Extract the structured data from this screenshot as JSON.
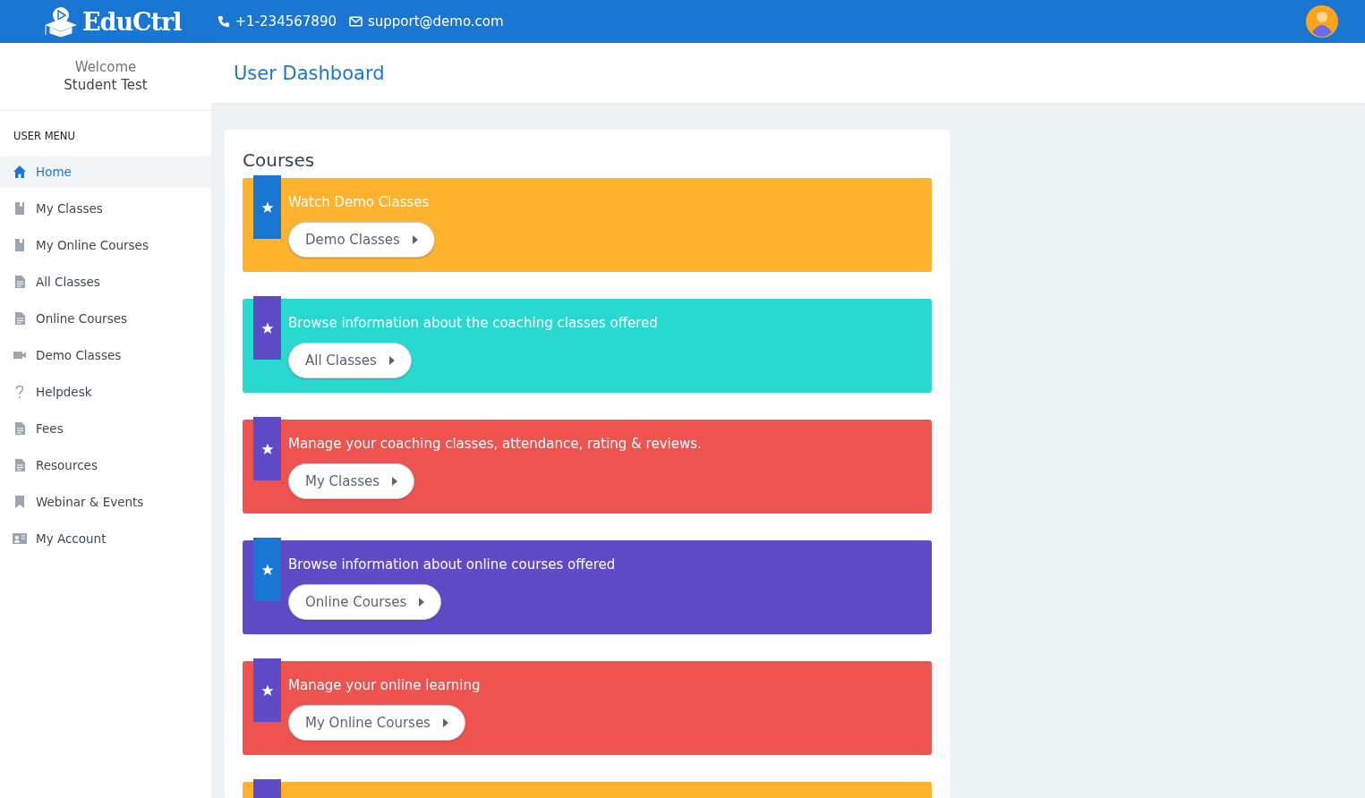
{
  "header": {
    "logo": "EduCtrl",
    "phone": "+1-234567890",
    "email": "support@demo.com"
  },
  "sidebar": {
    "welcome": "Welcome",
    "user": "Student Test",
    "menu_title": "USER MENU",
    "items": [
      {
        "label": "Home",
        "kind": "home",
        "selected": true
      },
      {
        "label": "My Classes",
        "kind": "book",
        "selected": false
      },
      {
        "label": "My Online Courses",
        "kind": "book",
        "selected": false
      },
      {
        "label": "All Classes",
        "kind": "document",
        "selected": false
      },
      {
        "label": "Online Courses",
        "kind": "document",
        "selected": false
      },
      {
        "label": "Demo Classes",
        "kind": "video",
        "selected": false
      },
      {
        "label": "Helpdesk",
        "kind": "question",
        "selected": false
      },
      {
        "label": "Fees",
        "kind": "document",
        "selected": false
      },
      {
        "label": "Resources",
        "kind": "document",
        "selected": false
      },
      {
        "label": "Webinar & Events",
        "kind": "bookmark",
        "selected": false
      },
      {
        "label": "My Account",
        "kind": "id-card",
        "selected": false
      }
    ]
  },
  "page_title": "User Dashboard",
  "courses": {
    "title": "Courses",
    "cards": [
      {
        "text": "Watch Demo Classes",
        "button": "Demo Classes",
        "color": "#ffb22e",
        "ribbon": {
          "color": "#1976d2"
        }
      },
      {
        "text": "Browse information about the coaching classes offered",
        "button": "All Classes",
        "color": "#29d9d0",
        "ribbon": {
          "color": "#5f4bc6"
        }
      },
      {
        "text": "Manage your coaching classes, attendance, rating & reviews.",
        "button": "My Classes",
        "color": "#ef5350",
        "ribbon": {
          "color": "#5f4bc6"
        }
      },
      {
        "text": "Browse information about online courses offered",
        "button": "Online Courses",
        "color": "#5f4bc6",
        "ribbon": {
          "color": "#1976d2"
        }
      },
      {
        "text": "Manage your online learning",
        "button": "My Online Courses",
        "color": "#ef5350",
        "ribbon": {
          "color": "#5f4bc6"
        }
      },
      {
        "color": "#ffb22e",
        "ribbon": {
          "color": "#5f4bc6"
        }
      }
    ]
  }
}
